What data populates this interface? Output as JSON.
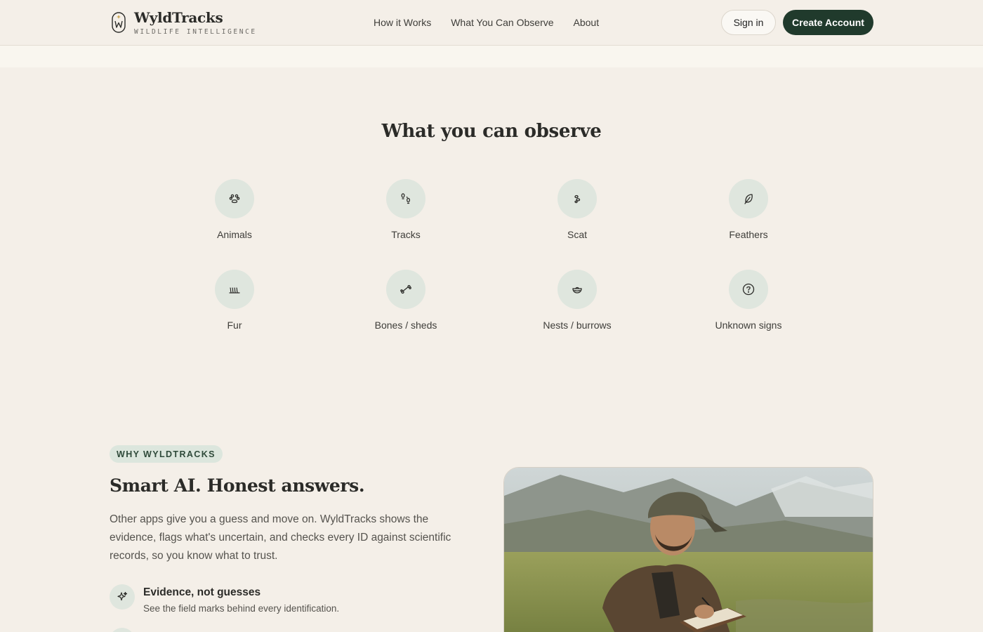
{
  "brand": {
    "name": "WyldTracks",
    "tagline": "WILDLIFE INTELLIGENCE"
  },
  "nav": {
    "items": [
      "How it Works",
      "What You Can Observe",
      "About"
    ]
  },
  "auth": {
    "signin": "Sign in",
    "create": "Create Account"
  },
  "observe": {
    "title": "What you can observe",
    "categories": [
      {
        "label": "Animals",
        "icon": "paw-icon"
      },
      {
        "label": "Tracks",
        "icon": "footprints-icon"
      },
      {
        "label": "Scat",
        "icon": "scat-icon"
      },
      {
        "label": "Feathers",
        "icon": "feather-icon"
      },
      {
        "label": "Fur",
        "icon": "fur-icon"
      },
      {
        "label": "Bones / sheds",
        "icon": "bone-icon"
      },
      {
        "label": "Nests / burrows",
        "icon": "nest-icon"
      },
      {
        "label": "Unknown signs",
        "icon": "question-icon"
      }
    ]
  },
  "why": {
    "pill": "WHY WYLDTRACKS",
    "title": "Smart AI. Honest answers.",
    "body": "Other apps give you a guess and move on. WyldTracks shows the evidence, flags what's uncertain, and checks every ID against scientific records, so you know what to trust.",
    "features": [
      {
        "title": "Evidence, not guesses",
        "subtitle": "See the field marks behind every identification.",
        "icon": "sparkle-icon"
      }
    ]
  },
  "colors": {
    "background": "#f4efe8",
    "accent": "#203a2c",
    "icon_bg": "#dfe6de"
  }
}
